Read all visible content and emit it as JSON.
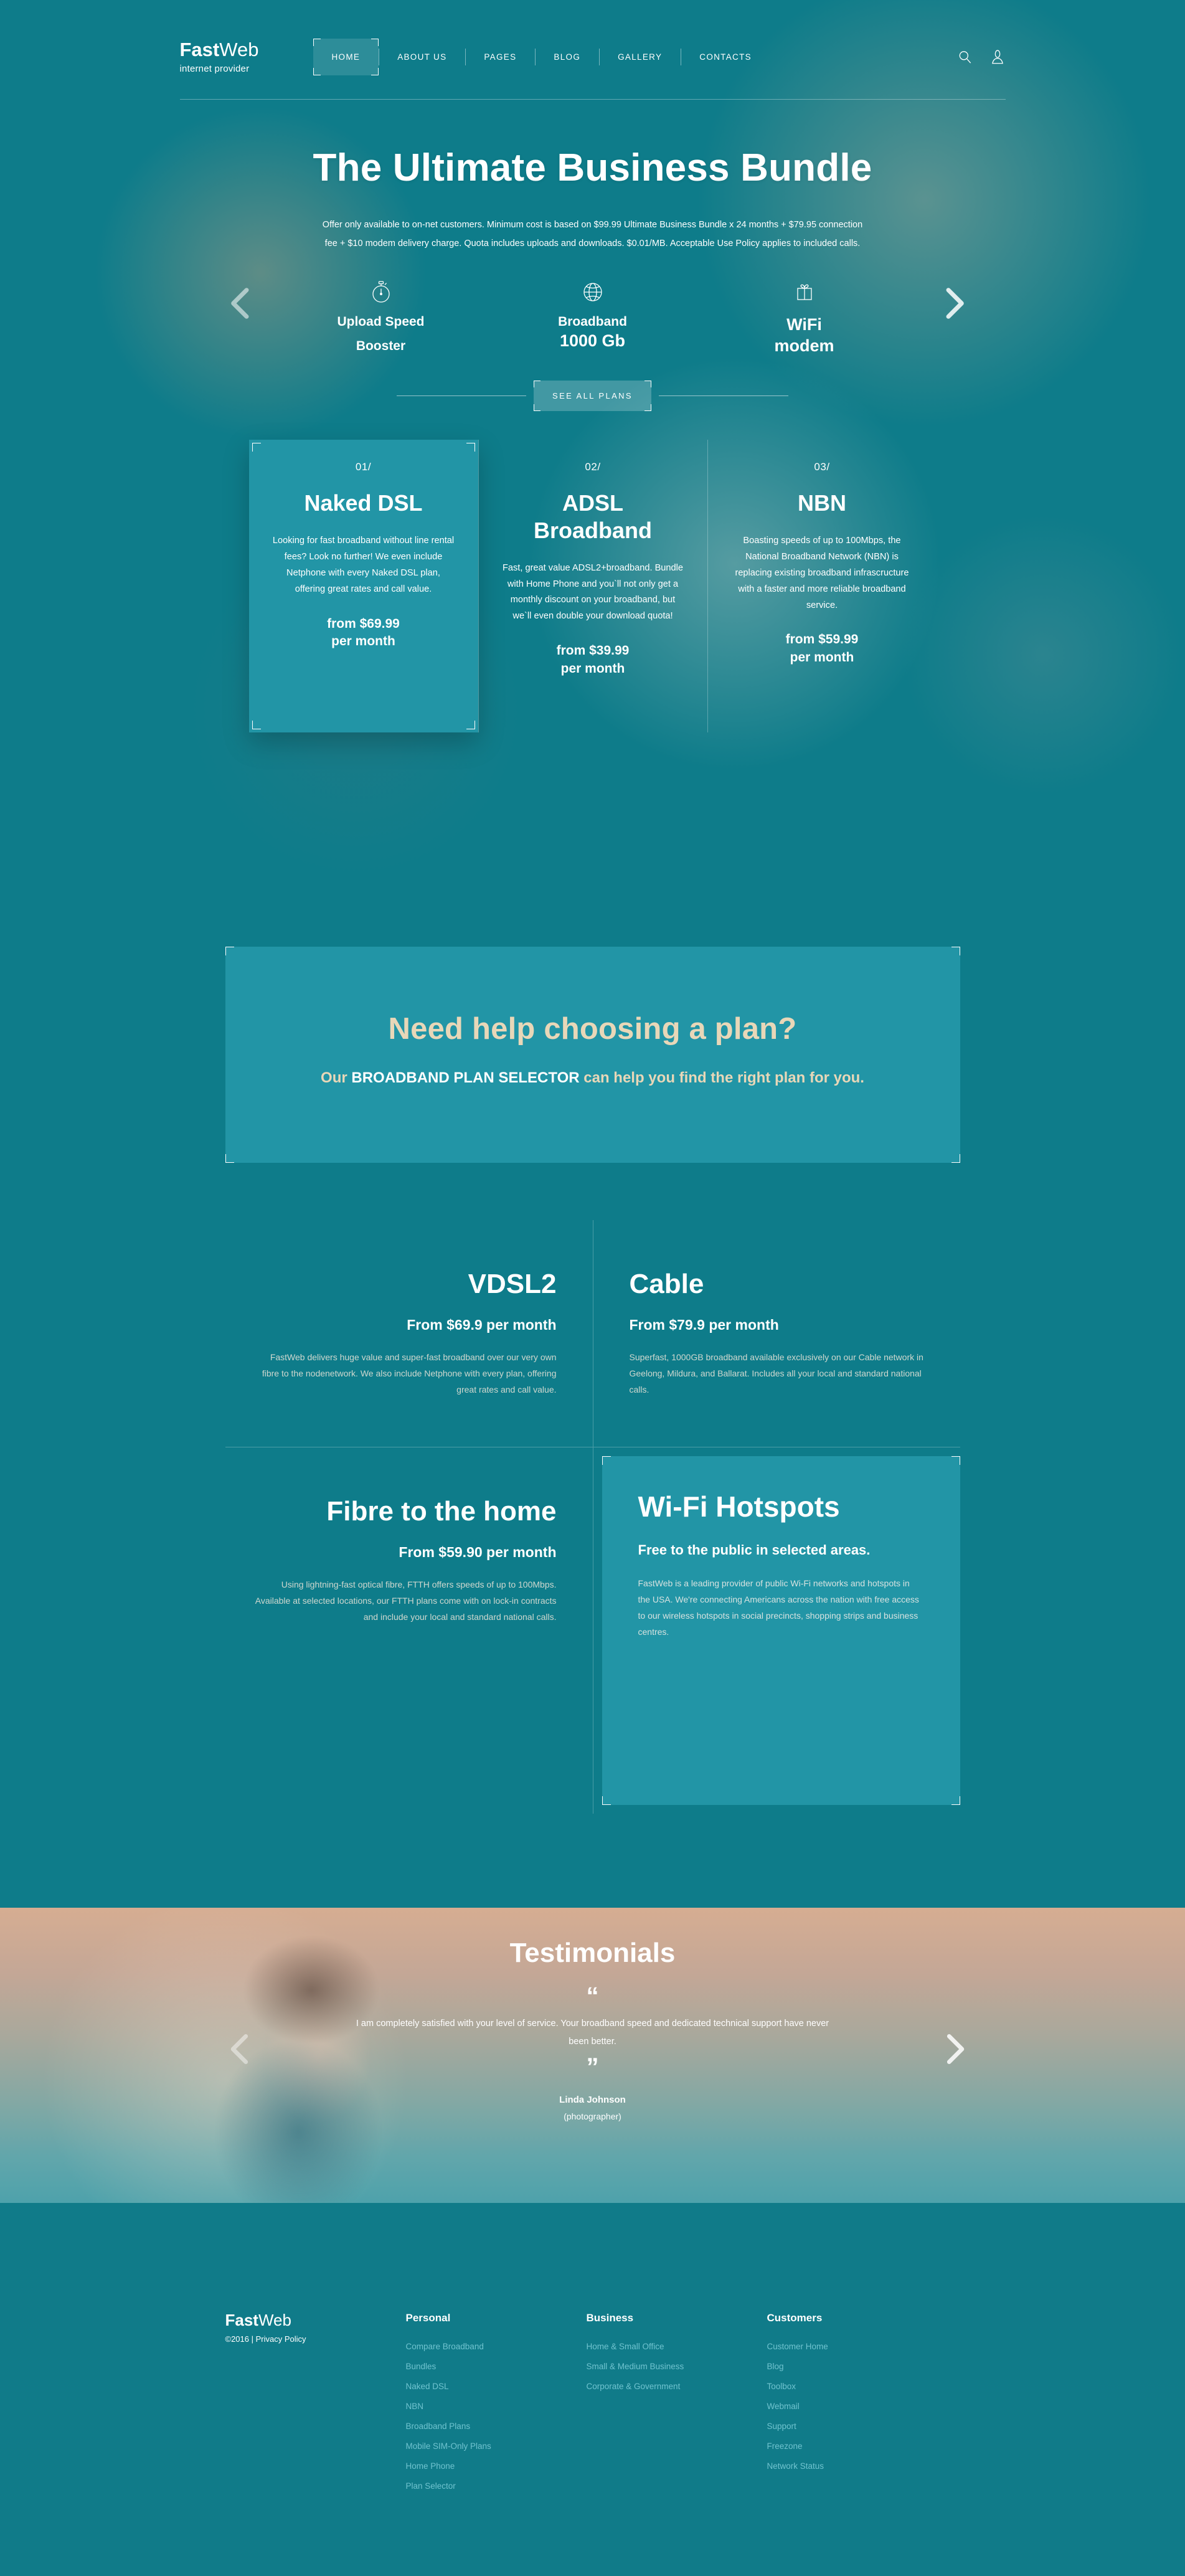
{
  "brand": {
    "bold": "Fast",
    "light": "Web",
    "tagline": "internet provider"
  },
  "nav": {
    "items": [
      {
        "label": "HOME",
        "active": true
      },
      {
        "label": "ABOUT US",
        "active": false
      },
      {
        "label": "PAGES",
        "active": false
      },
      {
        "label": "BLOG",
        "active": false
      },
      {
        "label": "GALLERY",
        "active": false
      },
      {
        "label": "CONTACTS",
        "active": false
      }
    ],
    "search_icon": "search-icon",
    "account_icon": "user-icon"
  },
  "hero": {
    "title": "The Ultimate Business Bundle",
    "description": "Offer only available to on-net customers. Minimum cost is based on $99.99 Ultimate Business Bundle x 24 months + $79.95 connection fee + $10 modem delivery charge. Quota includes uploads and downloads. $0.01/MB. Acceptable Use Policy applies to included calls.",
    "features": [
      {
        "icon": "stopwatch-icon",
        "line1": "Upload Speed",
        "line2": "Booster"
      },
      {
        "icon": "globe-icon",
        "line1": "Broadband",
        "line2": "1000 Gb"
      },
      {
        "icon": "gift-icon",
        "line1": "WiFi",
        "line2": "modem"
      }
    ],
    "cta_label": "SEE ALL PLANS",
    "prev_arrow": "chevron-left-icon",
    "next_arrow": "chevron-right-icon"
  },
  "plans": [
    {
      "number": "01/",
      "title": "Naked DSL",
      "description": "Looking for fast broadband without line rental fees? Look no further! We even include Netphone with every Naked DSL plan, offering great rates and call value.",
      "price_line1": "from $69.99",
      "price_line2": "per month",
      "featured": true
    },
    {
      "number": "02/",
      "title": "ADSL Broadband",
      "description": "Fast, great value ADSL2+broadband. Bundle with Home Phone and you`ll not only get a monthly discount on your broadband, but we`ll even double your download quota!",
      "price_line1": "from $39.99",
      "price_line2": "per month",
      "featured": false
    },
    {
      "number": "03/",
      "title": "NBN",
      "description": "Boasting speeds of up to 100Mbps, the National Broadband Network (NBN) is replacing existing broadband infrascructure with a faster and more reliable broadband service.",
      "price_line1": "from $59.99",
      "price_line2": "per month",
      "featured": false
    }
  ],
  "selector": {
    "title": "Need help choosing a plan?",
    "sub_before": "Our ",
    "sub_highlight": "BROADBAND PLAN SELECTOR",
    "sub_after": " can help you find the right plan for you."
  },
  "services": [
    {
      "title": "VDSL2",
      "price": "From $69.9 per month",
      "description": "FastWeb delivers huge value and super-fast broadband over our very own fibre to the nodenetwork. We also include Netphone with every plan, offering great rates and call value."
    },
    {
      "title": "Cable",
      "price": "From $79.9 per month",
      "description": "Superfast, 1000GB broadband available exclusively on our Cable network in Geelong, Mildura, and Ballarat. Includes all your local and standard national calls."
    },
    {
      "title": "Fibre to the home",
      "price": "From $59.90 per month",
      "description": "Using lightning-fast optical fibre, FTTH offers speeds of up to 100Mbps. Available at selected locations, our FTTH plans come with on lock-in contracts and include your local and standard national calls."
    },
    {
      "title": "Wi-Fi Hotspots",
      "price": "Free to the public in selected areas.",
      "description": "FastWeb is a leading provider of public Wi-Fi networks and hotspots in the USA. We're connecting Americans across the nation with free access to our wireless hotspots in social precincts, shopping strips and business centres."
    }
  ],
  "testimonials": {
    "title": "Testimonials",
    "quote_open": "“",
    "quote_close": "”",
    "text": "I am completely satisfied with your level of service. Your broadband speed and dedicated technical support have never been better.",
    "author": "Linda Johnson",
    "role": "(photographer)",
    "prev_arrow": "chevron-left-icon",
    "next_arrow": "chevron-right-icon"
  },
  "footer": {
    "brand": {
      "bold": "Fast",
      "light": "Web"
    },
    "copyright": "©2016 | Privacy Policy",
    "columns": [
      {
        "heading": "Personal",
        "links": [
          "Compare Broadband",
          "Bundles",
          "Naked DSL",
          "NBN",
          "Broadband Plans",
          "Mobile SIM-Only Plans",
          "Home Phone",
          "Plan Selector"
        ]
      },
      {
        "heading": "Business",
        "links": [
          "Home & Small Office",
          "Small & Medium Business",
          "Corporate & Government"
        ]
      },
      {
        "heading": "Customers",
        "links": [
          "Customer Home",
          "Blog",
          "Toolbox",
          "Webmail",
          "Support",
          "Freezone",
          "Network Status"
        ]
      }
    ]
  },
  "colors": {
    "teal_dark": "#0e7c8a",
    "teal_card": "#2295a6",
    "footer_bg": "#107b89",
    "accent_cream": "#e8d7b8",
    "link_teal": "#6fc3cf"
  }
}
